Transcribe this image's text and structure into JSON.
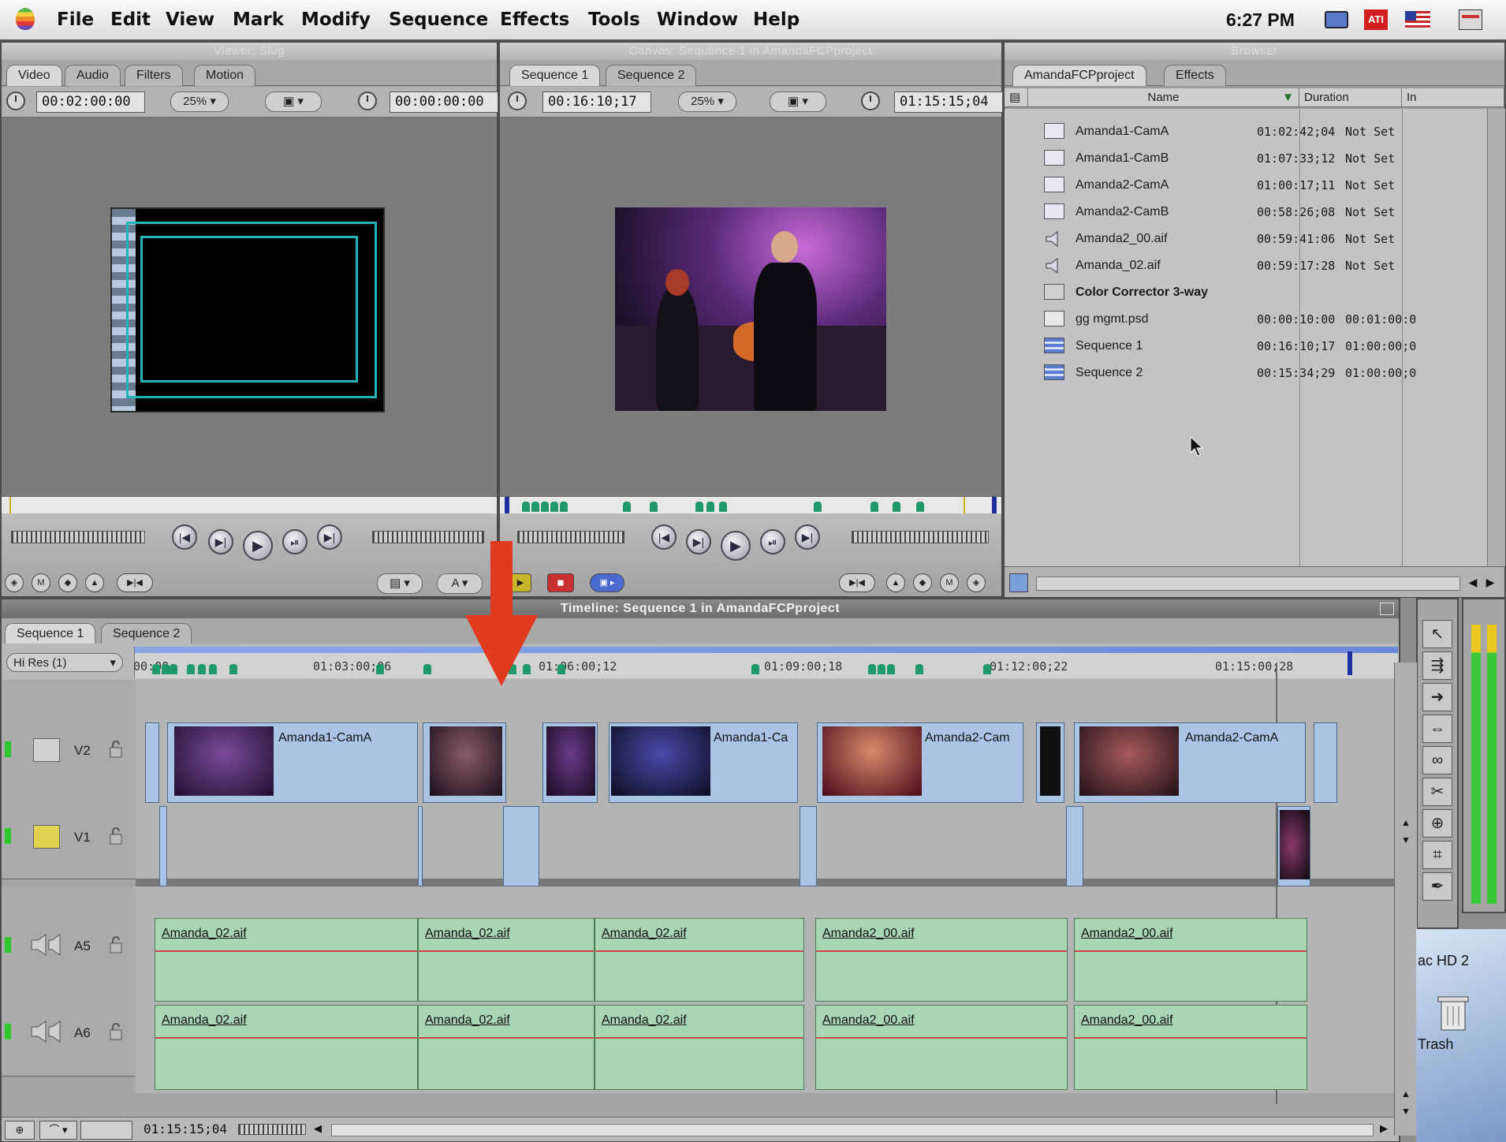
{
  "menubar": {
    "items": [
      "File",
      "Edit",
      "View",
      "Mark",
      "Modify",
      "Sequence",
      "Effects",
      "Tools",
      "Window",
      "Help"
    ],
    "clock": "6:27 PM"
  },
  "viewer": {
    "title": "Viewer: Slug",
    "tabs": [
      "Video",
      "Audio",
      "Filters",
      "Motion"
    ],
    "timecode_duration": "00:02:00:00",
    "zoom": "25%",
    "timecode_current": "00:00:00:00"
  },
  "canvas": {
    "title": "Canvas: Sequence 1 in AmandaFCPproject",
    "tabs": [
      "Sequence 1",
      "Sequence 2"
    ],
    "timecode_duration": "00:16:10;17",
    "zoom": "25%",
    "timecode_current": "01:15:15;04"
  },
  "browser": {
    "title": "Browser",
    "tabs": [
      "AmandaFCPproject",
      "Effects"
    ],
    "columns": [
      "Name",
      "Duration",
      "In"
    ],
    "rows": [
      {
        "icon": "clip-icon",
        "name": "Amanda1-CamA",
        "duration": "01:02:42;04",
        "in": "Not Set"
      },
      {
        "icon": "clip-icon",
        "name": "Amanda1-CamB",
        "duration": "01:07:33;12",
        "in": "Not Set"
      },
      {
        "icon": "clip-icon",
        "name": "Amanda2-CamA",
        "duration": "01:00:17;11",
        "in": "Not Set"
      },
      {
        "icon": "clip-icon",
        "name": "Amanda2-CamB",
        "duration": "00:58:26;08",
        "in": "Not Set"
      },
      {
        "icon": "audio-icon",
        "name": "Amanda2_00.aif",
        "duration": "00:59:41:06",
        "in": "Not Set"
      },
      {
        "icon": "audio-icon",
        "name": "Amanda_02.aif",
        "duration": "00:59:17:28",
        "in": "Not Set"
      },
      {
        "icon": "effect-icon",
        "name": "Color Corrector 3-way",
        "duration": "",
        "in": ""
      },
      {
        "icon": "graphic-icon",
        "name": "gg mgmt.psd",
        "duration": "00:00:10:00",
        "in": "00:01:00:0"
      },
      {
        "icon": "sequence-icon",
        "name": "Sequence 1",
        "duration": "00:16:10;17",
        "in": "01:00:00;0"
      },
      {
        "icon": "sequence-icon",
        "name": "Sequence 2",
        "duration": "00:15:34;29",
        "in": "01:00:00;0"
      }
    ]
  },
  "timeline": {
    "title": "Timeline: Sequence 1 in AmandaFCPproject",
    "tabs": [
      "Sequence 1",
      "Sequence 2"
    ],
    "quality": "Hi Res (1)",
    "ruler_labels": [
      "00:00",
      "01:03:00;06",
      "01:06:00;12",
      "01:09:00;18",
      "01:12:00;22",
      "01:15:00;28"
    ],
    "tracks": {
      "v2": "V2",
      "v1": "V1",
      "a5": "A5",
      "a6": "A6"
    },
    "video_clips_v2": [
      {
        "label": "Amanda1-CamA"
      },
      {
        "label": ""
      },
      {
        "label": ""
      },
      {
        "label": "Amanda1-Ca"
      },
      {
        "label": "Amanda2-Cam"
      },
      {
        "label": ""
      },
      {
        "label": "Amanda2-CamA"
      }
    ],
    "audio_clips_a5": [
      "Amanda_02.aif",
      "Amanda_02.aif",
      "Amanda_02.aif",
      "Amanda2_00.aif",
      "Amanda2_00.aif"
    ],
    "audio_clips_a6": [
      "Amanda_02.aif",
      "Amanda_02.aif",
      "Amanda_02.aif",
      "Amanda2_00.aif",
      "Amanda2_00.aif"
    ],
    "footer_timecode": "01:15:15;04"
  },
  "desktop": {
    "disk_label": "ac HD 2",
    "trash_label": "Trash"
  },
  "colors": {
    "video_clip": "#a9c4e4",
    "audio_clip": "#a8d5b4",
    "marker": "#1e9a6a",
    "arrow": "#e23a1f"
  }
}
